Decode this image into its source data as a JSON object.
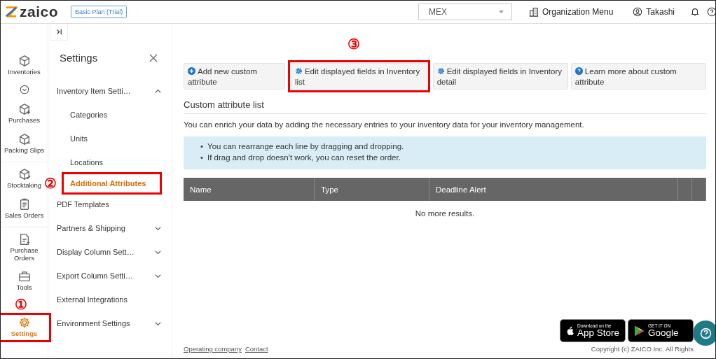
{
  "header": {
    "logo": "zaico",
    "plan_badge": "Basic Plan (Trial)",
    "location_select": {
      "value": "MEX"
    },
    "org_menu": "Organization Menu",
    "user": "Takashi"
  },
  "rail": [
    {
      "label": "Inventories",
      "kind": "box",
      "selected": false,
      "expand_toggle": true
    },
    {
      "label": "Purchases",
      "kind": "box-plus",
      "selected": false
    },
    {
      "label": "Packing Slips",
      "kind": "box-minus",
      "selected": false
    },
    {
      "label": "Stocktaking",
      "kind": "box-check",
      "selected": false
    },
    {
      "label": "Sales Orders",
      "kind": "clipboard",
      "selected": false
    },
    {
      "label": "Purchase Orders",
      "kind": "doc",
      "selected": false
    },
    {
      "label": "Tools",
      "kind": "toolbox",
      "selected": false
    },
    {
      "label": "Settings",
      "kind": "gear",
      "selected": true,
      "callout": "①"
    }
  ],
  "settings_panel": {
    "title": "Settings",
    "items": [
      {
        "label": "Inventory Item Setti…",
        "expanded": true,
        "children": [
          {
            "label": "Categories",
            "selected": false
          },
          {
            "label": "Units",
            "selected": false
          },
          {
            "label": "Locations",
            "selected": false
          },
          {
            "label": "Additional Attributes",
            "selected": true,
            "callout": "②"
          }
        ]
      },
      {
        "label": "PDF Templates"
      },
      {
        "label": "Partners & Shipping",
        "expanded": false
      },
      {
        "label": "Display Column Sett…",
        "expanded": false
      },
      {
        "label": "Export Column Setti…",
        "expanded": false
      },
      {
        "label": "External Integrations"
      },
      {
        "label": "Environment Settings",
        "expanded": false
      }
    ]
  },
  "actions": [
    {
      "label": "Add new custom attribute",
      "kind": "plus"
    },
    {
      "label": "Edit displayed fields in Inventory list",
      "kind": "gear",
      "callout": "③"
    },
    {
      "label": "Edit displayed fields in Inventory detail",
      "kind": "gear"
    },
    {
      "label": "Learn more about custom attribute",
      "kind": "help"
    }
  ],
  "section_title": "Custom attribute list",
  "description": "You can enrich your data by adding the necessary entries to your inventory data for your inventory management.",
  "info_notes": [
    {
      "marker": "•",
      "text": "You can rearrange each line by dragging and dropping."
    },
    {
      "marker": "•",
      "text": "If drag and drop doesn't work, you can reset the order."
    }
  ],
  "table": {
    "columns": [
      "Name",
      "Type",
      "Deadline Alert"
    ],
    "empty_message": "No more results."
  },
  "footer": {
    "links": [
      "Operating company",
      "Contact"
    ],
    "copyright": "Copyright (c) ZAICO Inc. All Rights",
    "store_badges": [
      {
        "kind": "apple",
        "small": "Download on the",
        "big": "App Store"
      },
      {
        "kind": "google",
        "small": "GET IT ON",
        "big": "Google"
      }
    ]
  }
}
